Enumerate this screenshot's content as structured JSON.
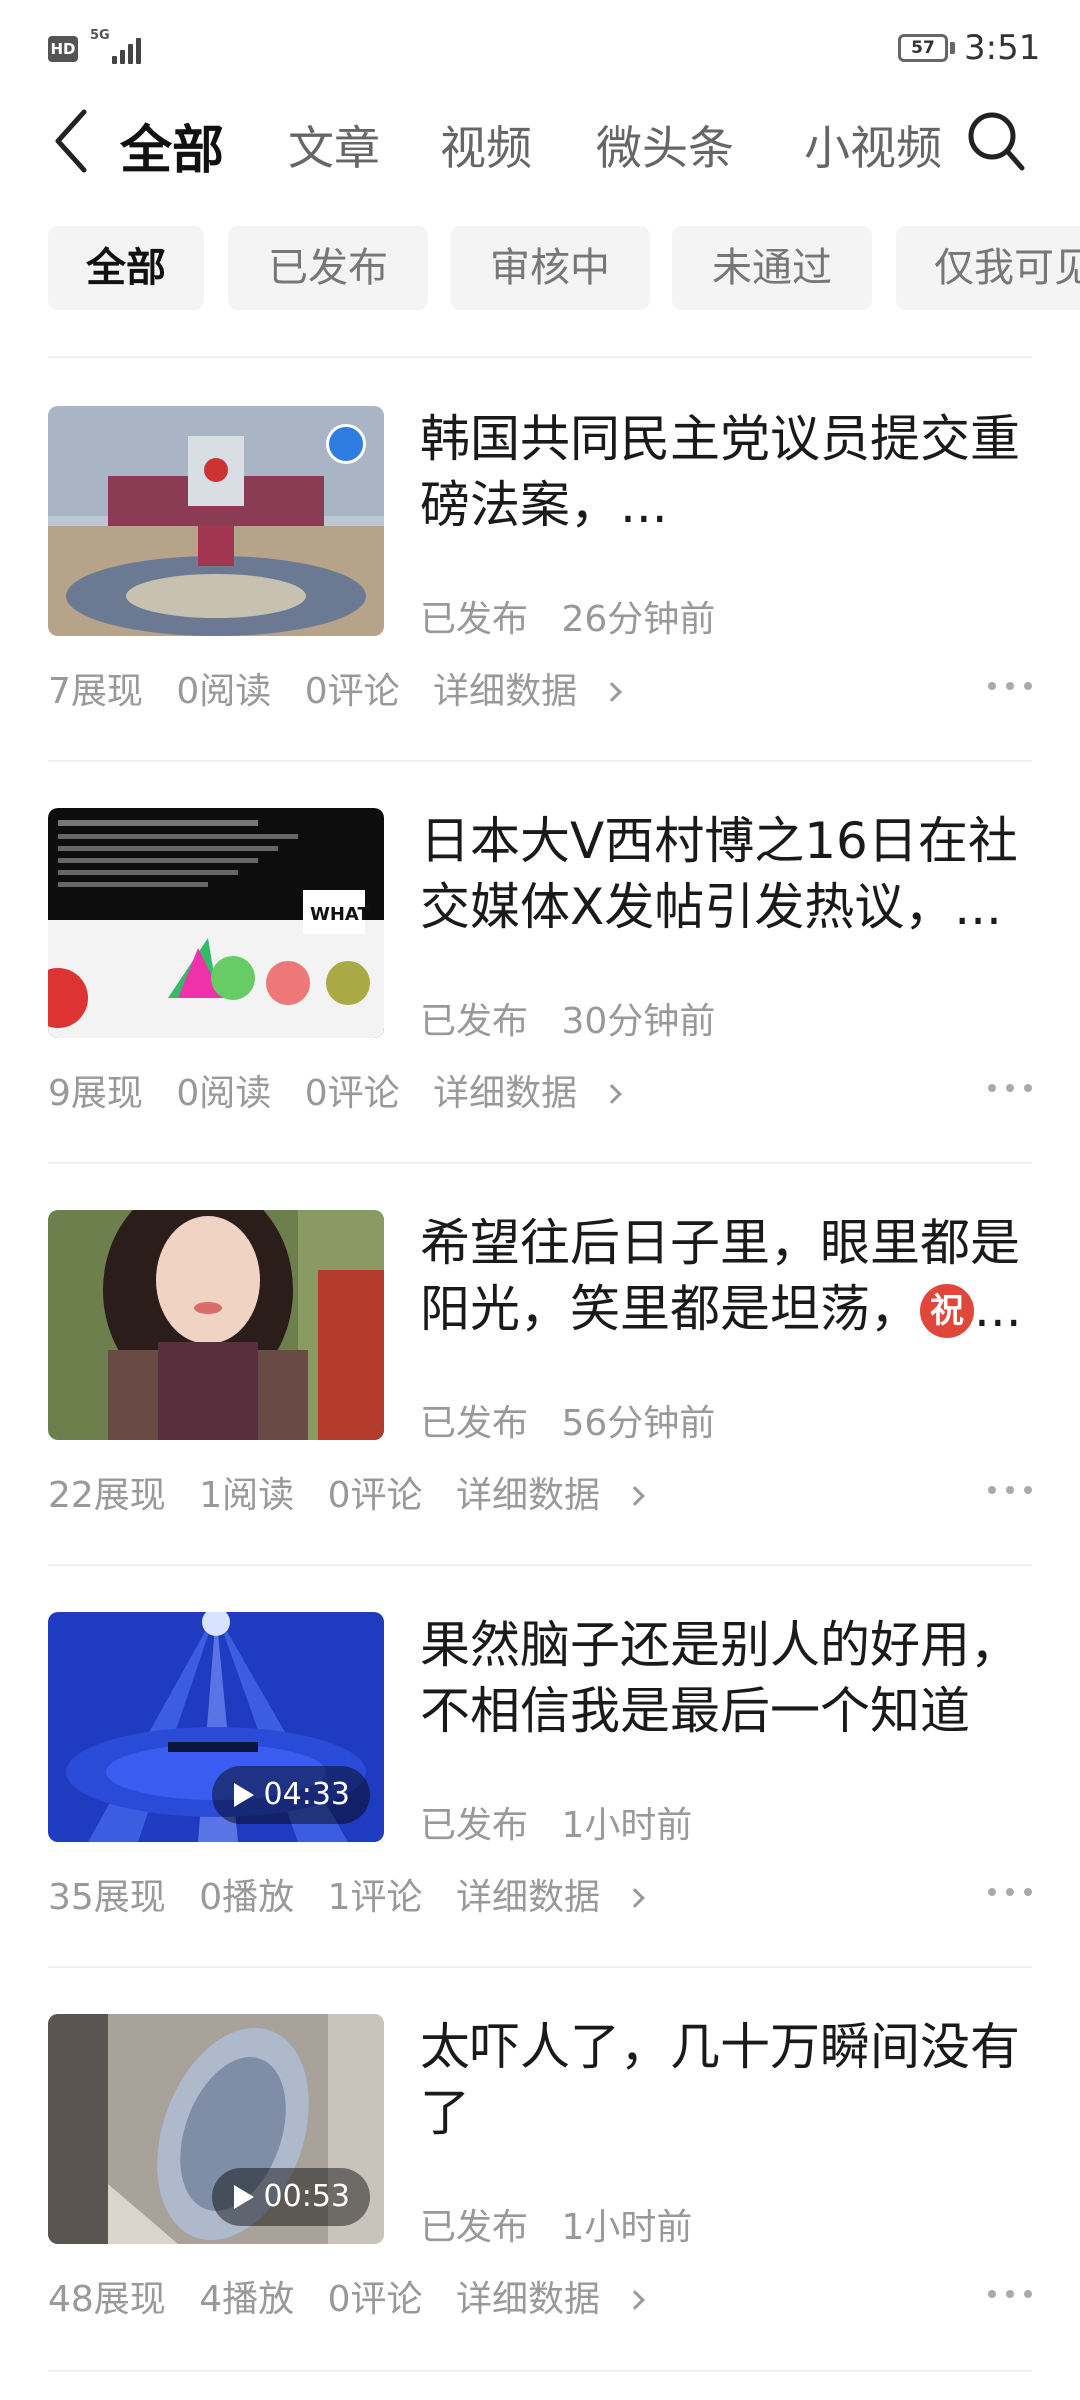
{
  "status_bar": {
    "hd": "HD",
    "network": "5G",
    "battery": "57",
    "time": "3:51"
  },
  "nav": {
    "tabs": [
      "全部",
      "文章",
      "视频",
      "微头条",
      "小视频"
    ]
  },
  "filters": [
    "全部",
    "已发布",
    "审核中",
    "未通过",
    "仅我可见"
  ],
  "items": [
    {
      "title": "韩国共同民主党议员提交重磅法案，...",
      "status": "已发布",
      "time": "26分钟前",
      "impressions": "7展现",
      "views": "0阅读",
      "comments": "0评论",
      "detail": "详细数据",
      "thumb": "parliament"
    },
    {
      "title": "日本大V西村博之16日在社交媒体X发帖引发热议，...",
      "status": "已发布",
      "time": "30分钟前",
      "impressions": "9展现",
      "views": "0阅读",
      "comments": "0评论",
      "detail": "详细数据",
      "thumb": "screenshot"
    },
    {
      "title": "希望往后日子里，眼里都是阳光，笑里都是坦荡，",
      "emoji": "祝",
      "title_tail": "...",
      "status": "已发布",
      "time": "56分钟前",
      "impressions": "22展现",
      "views": "1阅读",
      "comments": "0评论",
      "detail": "详细数据",
      "thumb": "portrait"
    },
    {
      "title": "果然脑子还是别人的好用，不相信我是最后一个知道",
      "status": "已发布",
      "time": "1小时前",
      "impressions": "35展现",
      "views": "0播放",
      "comments": "1评论",
      "detail": "详细数据",
      "duration": "04:33",
      "thumb": "stage"
    },
    {
      "title": "太吓人了，几十万瞬间没有了",
      "status": "已发布",
      "time": "1小时前",
      "impressions": "48展现",
      "views": "4播放",
      "comments": "0评论",
      "detail": "详细数据",
      "duration": "00:53",
      "thumb": "car"
    }
  ]
}
